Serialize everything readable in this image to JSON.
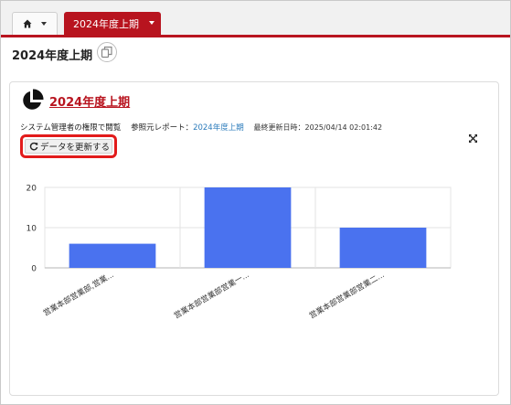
{
  "tabs": {
    "home_icon": "home-icon",
    "report_tab_label": "2024年度上期"
  },
  "page": {
    "title": "2024年度上期"
  },
  "card": {
    "title": "2024年度上期",
    "permission_text": "システム管理者の権限で閲覧",
    "source_label": "参照元レポート：",
    "source_link": "2024年度上期",
    "updated_label": "最終更新日時：",
    "updated_value": "2025/04/14 02:01:42",
    "refresh_label": "データを更新する",
    "accent_color": "#b8141f",
    "highlight_color": "#e21b1b"
  },
  "chart_data": {
    "type": "bar",
    "categories": [
      "営業本部営業部,営業...",
      "営業本部営業部営業一...",
      "営業本部営業部営業二..."
    ],
    "values": [
      6,
      20,
      10
    ],
    "yticks": [
      0,
      10,
      20
    ],
    "ylim": [
      0,
      20
    ],
    "color": "#4a72ef",
    "grid": true
  }
}
